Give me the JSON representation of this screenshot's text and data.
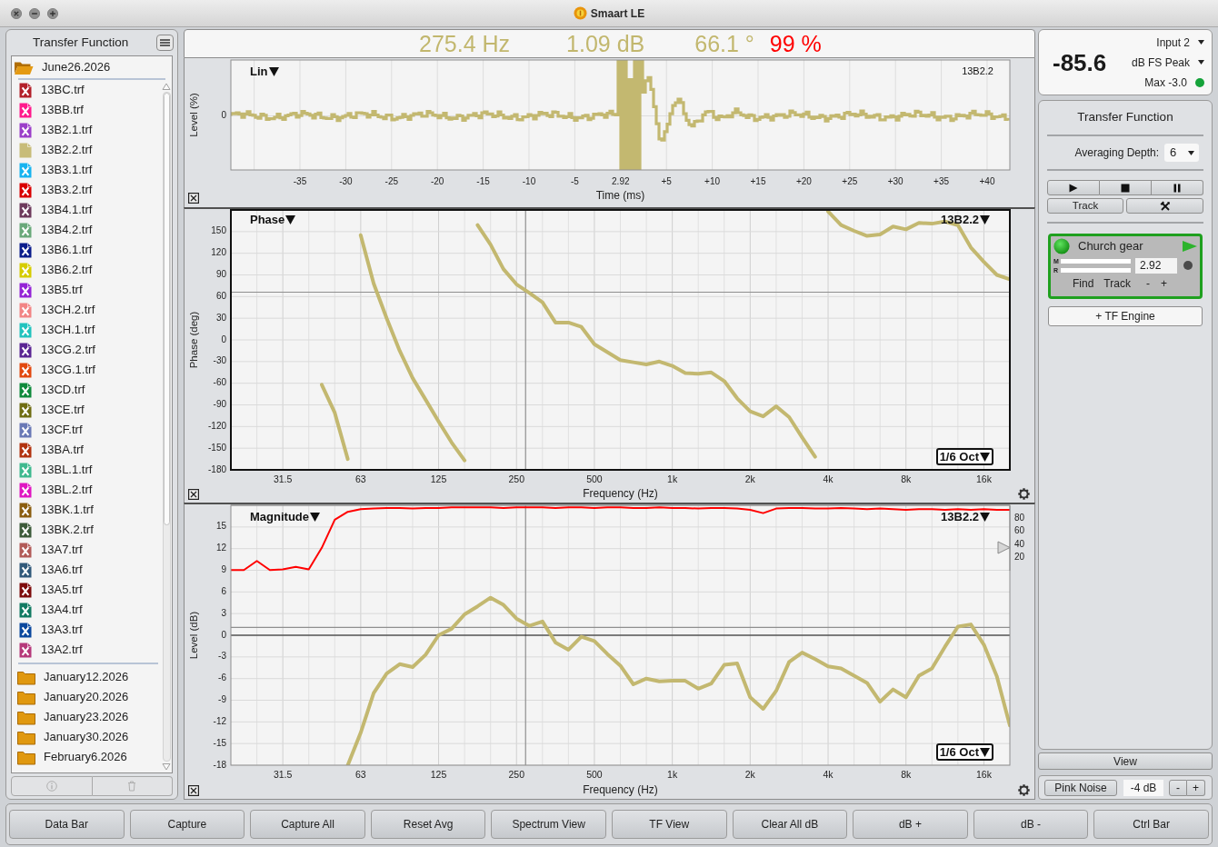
{
  "window": {
    "title": "Smaart LE",
    "controls": [
      {
        "kind": "close"
      },
      {
        "kind": "minimize"
      },
      {
        "kind": "zoom"
      }
    ]
  },
  "sidebar": {
    "title": "Transfer Function",
    "folders": [
      {
        "name": "June26.2026",
        "expanded": true,
        "children": [
          {
            "name": "13BC.trf",
            "color": "#b3202a",
            "hidden": true
          },
          {
            "name": "13BB.trf",
            "color": "#ff1a8c",
            "hidden": true
          },
          {
            "name": "13B2.1.trf",
            "color": "#9b3fc9",
            "hidden": true
          },
          {
            "name": "13B2.2.trf",
            "color": "#c8bc78",
            "hidden": false
          },
          {
            "name": "13B3.1.trf",
            "color": "#18b4f0",
            "hidden": true
          },
          {
            "name": "13B3.2.trf",
            "color": "#d90000",
            "hidden": true
          },
          {
            "name": "13B4.1.trf",
            "color": "#6e3a5c",
            "hidden": true
          },
          {
            "name": "13B4.2.trf",
            "color": "#6aa97a",
            "hidden": true
          },
          {
            "name": "13B6.1.trf",
            "color": "#0b1d8c",
            "hidden": true
          },
          {
            "name": "13B6.2.trf",
            "color": "#d6cc00",
            "hidden": true
          },
          {
            "name": "13B5.trf",
            "color": "#9424d6",
            "hidden": true
          },
          {
            "name": "13CH.2.trf",
            "color": "#f28585",
            "hidden": true
          },
          {
            "name": "13CH.1.trf",
            "color": "#22c3be",
            "hidden": true
          },
          {
            "name": "13CG.2.trf",
            "color": "#5b2593",
            "hidden": true
          },
          {
            "name": "13CG.1.trf",
            "color": "#e2480f",
            "hidden": true
          },
          {
            "name": "13CD.trf",
            "color": "#0f8a3c",
            "hidden": true
          },
          {
            "name": "13CE.trf",
            "color": "#6f6d12",
            "hidden": true
          },
          {
            "name": "13CF.trf",
            "color": "#6a79b6",
            "hidden": true
          },
          {
            "name": "13BA.trf",
            "color": "#b2330f",
            "hidden": true
          },
          {
            "name": "13BL.1.trf",
            "color": "#3fb98f",
            "hidden": true
          },
          {
            "name": "13BL.2.trf",
            "color": "#e016c2",
            "hidden": true
          },
          {
            "name": "13BK.1.trf",
            "color": "#8b5e10",
            "hidden": true
          },
          {
            "name": "13BK.2.trf",
            "color": "#3d5b3a",
            "hidden": true
          },
          {
            "name": "13A7.trf",
            "color": "#b25b58",
            "hidden": true
          },
          {
            "name": "13A6.trf",
            "color": "#31597a",
            "hidden": true
          },
          {
            "name": "13A5.trf",
            "color": "#7e0c0c",
            "hidden": true
          },
          {
            "name": "13A4.trf",
            "color": "#127a62",
            "hidden": true
          },
          {
            "name": "13A3.trf",
            "color": "#0b489e",
            "hidden": true
          },
          {
            "name": "13A2.trf",
            "color": "#b6397a",
            "hidden": true
          }
        ]
      },
      {
        "name": "January12.2026",
        "expanded": false
      },
      {
        "name": "January20.2026",
        "expanded": false
      },
      {
        "name": "January23.2026",
        "expanded": false
      },
      {
        "name": "January30.2026",
        "expanded": false
      },
      {
        "name": "February6.2026",
        "expanded": false
      }
    ],
    "footer_buttons": [
      {
        "kind": "info",
        "disabled": true
      },
      {
        "kind": "trash",
        "disabled": true
      }
    ]
  },
  "readout": [
    {
      "kind": "frequency",
      "text": "275.4 Hz",
      "color": "#c2b76e"
    },
    {
      "kind": "magnitude",
      "text": "1.09 dB",
      "color": "#c2b76e"
    },
    {
      "kind": "phase",
      "text": "66.1 °",
      "color": "#c2b76e"
    },
    {
      "kind": "coherence",
      "text": "99 %",
      "color": "#ff0000"
    }
  ],
  "impulse": {
    "mode": "Lin",
    "trace": "13B2.2",
    "ylabel": "Level (%)",
    "yticks": [
      "0"
    ],
    "xticks": [
      "-35",
      "-30",
      "-25",
      "-20",
      "-15",
      "-10",
      "-5",
      "2.92",
      "+5",
      "+10",
      "+15",
      "+20",
      "+25",
      "+30",
      "+35",
      "+40"
    ],
    "xlabel": "Time (ms)"
  },
  "phase": {
    "selected": true,
    "mode": "Phase",
    "smoothing": "1/6 Oct",
    "chart_data": {
      "type": "line",
      "xlabel": "Frequency (Hz)",
      "ylabel": "Phase (deg)",
      "categories": [
        null,
        null,
        null,
        null,
        "31.5",
        null,
        null,
        null,
        null,
        null,
        "63",
        null,
        null,
        null,
        null,
        null,
        "125",
        null,
        null,
        null,
        null,
        null,
        "250",
        null,
        null,
        null,
        null,
        null,
        "500",
        null,
        null,
        null,
        null,
        null,
        "1k",
        null,
        null,
        null,
        null,
        null,
        "2k",
        null,
        null,
        null,
        null,
        null,
        "4k",
        null,
        null,
        null,
        null,
        null,
        "8k",
        null,
        null,
        null,
        null,
        null,
        "16k",
        null,
        null
      ],
      "series": [
        {
          "name": "13B2.2",
          "color": "#c3b870",
          "values": [
            null,
            null,
            null,
            null,
            null,
            null,
            null,
            -62,
            -101,
            -165,
            145,
            78,
            30,
            -15,
            -53,
            -83,
            -113,
            -142,
            -167,
            159,
            132,
            98,
            77,
            65,
            52,
            24,
            24,
            18,
            -6,
            -17,
            -28,
            -31,
            -34,
            -30,
            -36,
            -46,
            -47,
            -45,
            -57,
            -81,
            -99,
            -106,
            -92,
            -107,
            -135,
            -162,
            178,
            159,
            151,
            144,
            146,
            157,
            153,
            162,
            161,
            164,
            159,
            128,
            108,
            90,
            84
          ]
        }
      ],
      "ylim": [
        -180,
        180
      ],
      "yticks": [
        150,
        120,
        90,
        60,
        30,
        0,
        -30,
        -60,
        -90,
        -120,
        -150,
        -180
      ],
      "grid": true,
      "ref_lines": [
        {
          "axis": "y",
          "value": 66.1,
          "color": "#8f8f8f"
        }
      ]
    }
  },
  "magnitude": {
    "selected": false,
    "mode": "Magnitude",
    "smoothing": "1/6 Oct",
    "chart_data": {
      "type": "line",
      "xlabel": "Frequency (Hz)",
      "ylabel": "Level (dB)",
      "categories": [
        null,
        null,
        null,
        null,
        "31.5",
        null,
        null,
        null,
        null,
        null,
        "63",
        null,
        null,
        null,
        null,
        null,
        "125",
        null,
        null,
        null,
        null,
        null,
        "250",
        null,
        null,
        null,
        null,
        null,
        "500",
        null,
        null,
        null,
        null,
        null,
        "1k",
        null,
        null,
        null,
        null,
        null,
        "2k",
        null,
        null,
        null,
        null,
        null,
        "4k",
        null,
        null,
        null,
        null,
        null,
        "8k",
        null,
        null,
        null,
        null,
        null,
        "16k",
        null,
        null
      ],
      "series": [
        {
          "name": "13B2.2",
          "color": "#c3b870",
          "values": [
            null,
            null,
            null,
            null,
            null,
            null,
            null,
            null,
            null,
            -18,
            -13.5,
            -8,
            -5.3,
            -4,
            -4.4,
            -2.7,
            0,
            0.9,
            2.9,
            4,
            5.2,
            4.2,
            2.3,
            1.3,
            1.9,
            -1,
            -2,
            -0.2,
            -0.8,
            -2.6,
            -4.2,
            -6.8,
            -6,
            -6.4,
            -6.3,
            -6.3,
            -7.4,
            -6.7,
            -4.1,
            -3.9,
            -8.6,
            -10.2,
            -7.7,
            -3.7,
            -2.4,
            -3.3,
            -4.3,
            -4.6,
            -5.6,
            -6.6,
            -9.2,
            -7.5,
            -8.6,
            -5.6,
            -4.6,
            -1.6,
            1.2,
            1.5,
            -1.3,
            -5.7,
            -12.5
          ]
        }
      ],
      "ylim": [
        -18,
        18
      ],
      "yticks": [
        15,
        12,
        9,
        6,
        3,
        0,
        -3,
        -6,
        -9,
        -12,
        -15,
        -18
      ],
      "grid": true,
      "ref_lines": [
        {
          "axis": "y",
          "value": 1.09,
          "color": "#8f8f8f"
        },
        {
          "axis": "y",
          "value": 0,
          "color": "#111111"
        }
      ]
    },
    "coherence": {
      "chart_data": {
        "type": "line",
        "categories": [
          null,
          null,
          null,
          null,
          null,
          null,
          null,
          null,
          null,
          null,
          null,
          null,
          null,
          null,
          null,
          null,
          null,
          null,
          null,
          null,
          null,
          null,
          null,
          null,
          null,
          null,
          null,
          null,
          null,
          null,
          null,
          null,
          null,
          null,
          null,
          null,
          null,
          null,
          null,
          null,
          null,
          null,
          null,
          null,
          null,
          null,
          null,
          null,
          null,
          null,
          null,
          null,
          null,
          null,
          null,
          null,
          null,
          null,
          null,
          null,
          null
        ],
        "series": [
          {
            "color": "#ff0000",
            "values": [
              1,
              1,
              15,
              1,
              2,
              6,
              2,
              35,
              78,
              90,
              94,
              95,
              96,
              96,
              95,
              96,
              96,
              97,
              97,
              97,
              97,
              96,
              97,
              97,
              97,
              96,
              97,
              97,
              96,
              97,
              97,
              96,
              96,
              97,
              96,
              96,
              95,
              96,
              96,
              95,
              93,
              88,
              95,
              96,
              96,
              95,
              95,
              96,
              95,
              94,
              95,
              94,
              93,
              94,
              94,
              93,
              94,
              93,
              94,
              93,
              93
            ]
          }
        ],
        "ylim": [
          0,
          100
        ],
        "yticks": [
          80,
          60,
          40,
          20
        ]
      }
    }
  },
  "level_meter": {
    "reading": "-85.6",
    "input": "Input 2",
    "scale": "dB FS Peak",
    "max": "Max -3.0",
    "signal_ok": true
  },
  "control_panel": {
    "title": "Transfer Function",
    "averaging_label": "Averaging Depth:",
    "averaging_value": "6",
    "transport": [
      {
        "kind": "play"
      },
      {
        "kind": "stop"
      },
      {
        "kind": "pause"
      }
    ],
    "track": "Track",
    "engine": {
      "selected": true,
      "on": true,
      "running": true,
      "name": "Church gear",
      "meters": [
        {
          "label": "M"
        },
        {
          "label": "R"
        }
      ],
      "delay": "2.92",
      "actions": [
        "Find",
        "Track",
        "-",
        "+"
      ]
    },
    "add_engine": "+ TF Engine"
  },
  "view_button": "View",
  "generator": {
    "label": "Pink Noise",
    "gain": "-4 dB",
    "steppers": [
      "-",
      "+"
    ]
  },
  "bottom_bar": {
    "buttons": [
      "Data Bar",
      "Capture",
      "Capture All",
      "Reset Avg",
      "Spectrum View",
      "TF View",
      "Clear All dB",
      "dB +",
      "dB -",
      "Ctrl Bar"
    ]
  }
}
